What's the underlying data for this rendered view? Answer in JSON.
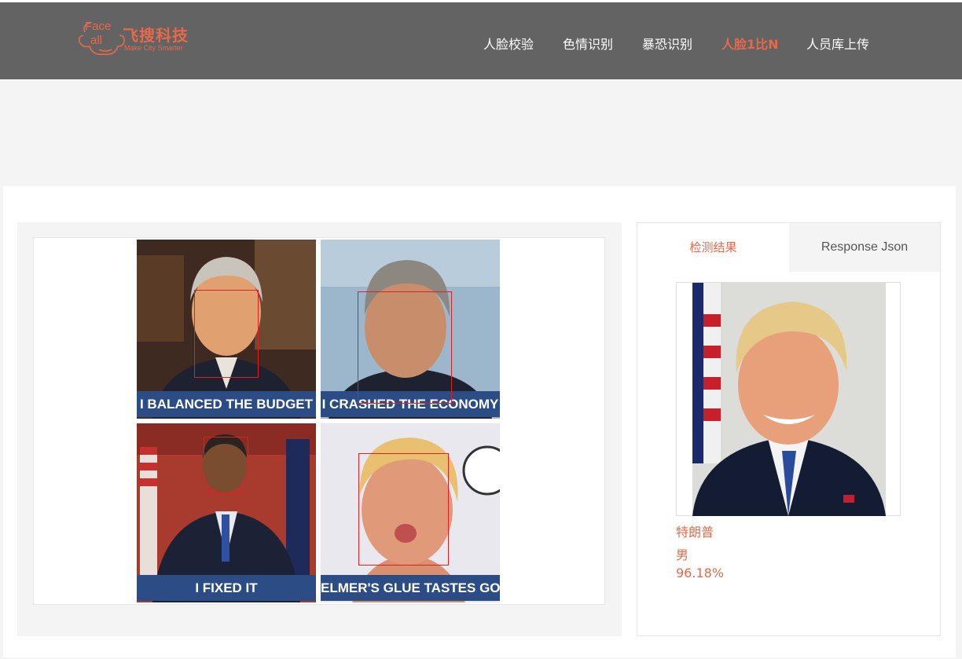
{
  "logo": {
    "face_text": "Face",
    "all_text": "all",
    "brand_cn": "飞搜科技",
    "tagline": "Make City Smarter"
  },
  "nav": {
    "items": [
      {
        "label": "人脸校验",
        "active": false
      },
      {
        "label": "色情识别",
        "active": false
      },
      {
        "label": "暴恐识别",
        "active": false
      },
      {
        "label": "人脸1比N",
        "active": true
      },
      {
        "label": "人员库上传",
        "active": false
      }
    ]
  },
  "collage": {
    "captions": [
      "I BALANCED THE BUDGET",
      "I CRASHED THE ECONOMY",
      "I FIXED IT",
      "ELMER'S GLUE TASTES GOOD"
    ]
  },
  "result": {
    "tabs": [
      "检测结果",
      "Response Json"
    ],
    "name": "特朗普",
    "gender": "男",
    "confidence": "96.18%"
  },
  "colors": {
    "accent": "#e8684a",
    "header_bg": "#636363",
    "caption_bg": "#2c4c86",
    "face_box": "#e02020"
  }
}
